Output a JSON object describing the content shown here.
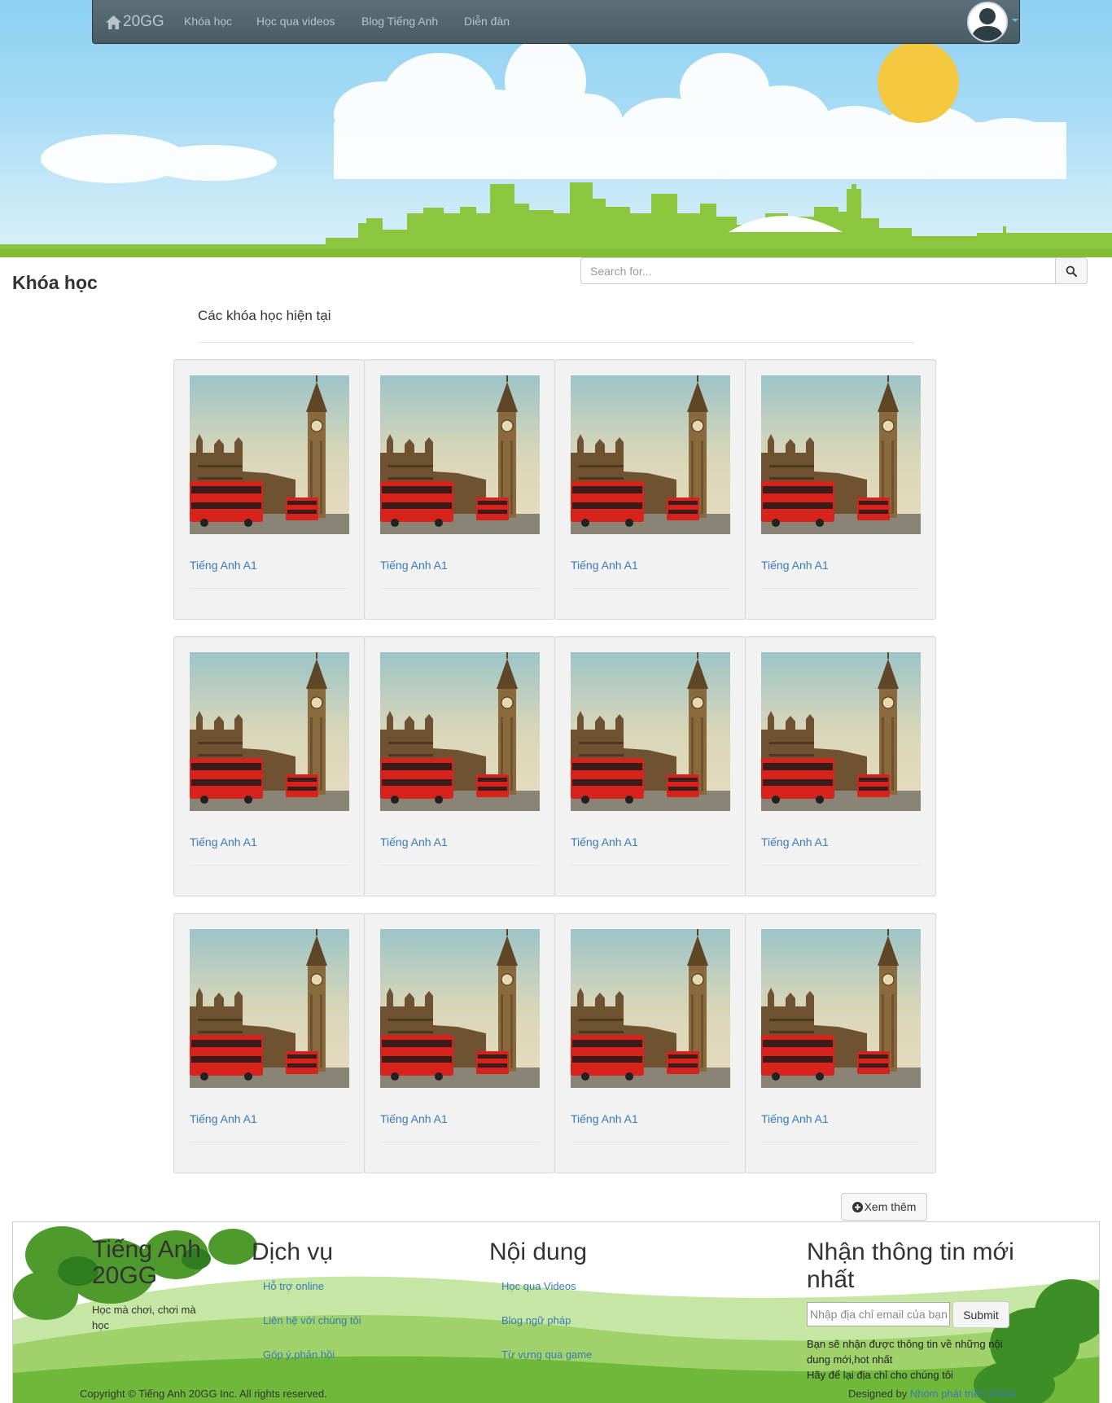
{
  "navbar": {
    "brand": "20GG",
    "links": [
      "Khóa học",
      "Học qua videos",
      "Blog Tiếng Anh",
      "Diễn đàn"
    ]
  },
  "page": {
    "title": "Khóa học",
    "section_heading": "Các khóa học hiện tại"
  },
  "search": {
    "placeholder": "Search for..."
  },
  "courses": [
    {
      "title": "Tiếng Anh A1"
    },
    {
      "title": "Tiếng Anh A1"
    },
    {
      "title": "Tiếng Anh A1"
    },
    {
      "title": "Tiếng Anh A1"
    },
    {
      "title": "Tiếng Anh A1"
    },
    {
      "title": "Tiếng Anh A1"
    },
    {
      "title": "Tiếng Anh A1"
    },
    {
      "title": "Tiếng Anh A1"
    },
    {
      "title": "Tiếng Anh A1"
    },
    {
      "title": "Tiếng Anh A1"
    },
    {
      "title": "Tiếng Anh A1"
    },
    {
      "title": "Tiếng Anh A1"
    }
  ],
  "more_button": "Xem thêm",
  "footer": {
    "brand": "Tiếng Anh 20GG",
    "tagline": "Học mà chơi, chơi mà học",
    "services": {
      "heading": "Dịch vụ",
      "links": [
        "Hỗ trợ online",
        "Liên hệ với chúng tôi",
        "Góp ý,phản hồi"
      ]
    },
    "content": {
      "heading": "Nội dung",
      "links": [
        "Học qua Videos",
        "Blog ngữ pháp",
        "Từ vựng qua game"
      ]
    },
    "newsletter": {
      "heading": "Nhận thông tin mới nhất",
      "placeholder": "Nhập địa chỉ email của bạn",
      "submit": "Submit",
      "note_1": "Bạn sẽ nhận được thông tin về những nội dung mới,hot nhất",
      "note_2": "Hãy để lại địa chỉ cho chúng tôi"
    },
    "copyright": "Copyright © Tiếng Anh 20GG Inc. All rights reserved.",
    "designed_by_label": "Designed by",
    "designed_by_name": "Nhóm phát triển 20GG"
  },
  "colors": {
    "sky": "#8dd0f2",
    "grass": "#8cc63f",
    "sun": "#f5c842",
    "navbar": "#4f626b",
    "link": "#3a7ab7",
    "bus_red": "#d8231c"
  },
  "icons": [
    "home-icon",
    "user-avatar-icon",
    "search-icon",
    "plus-circle-icon"
  ]
}
